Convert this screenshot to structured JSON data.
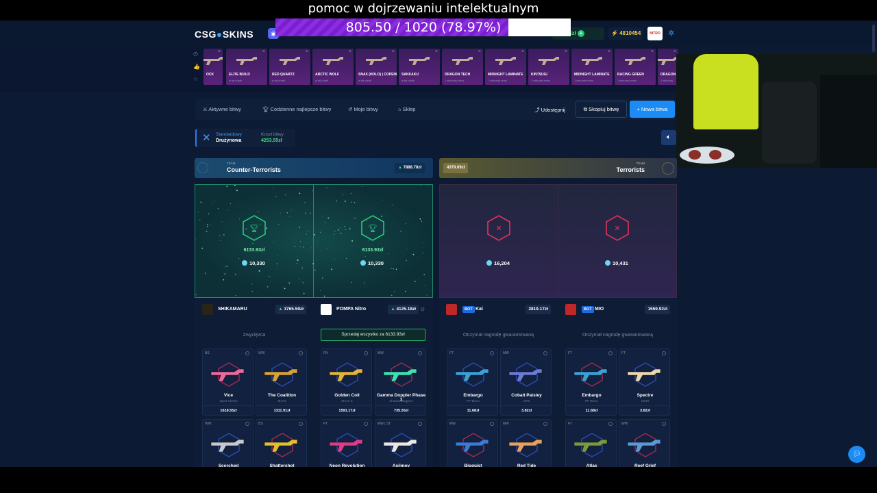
{
  "stream": {
    "title": "pomoc w dojrzewaniu intelektualnym",
    "progress_text": "805.50 / 1020 (78.97%)",
    "progress_fraction": 0.7897
  },
  "header": {
    "logo_left": "CSG",
    "logo_right": "SKINS",
    "balance_partial": "108.76zł",
    "coins": "4810454",
    "accent": "#1d8bf5"
  },
  "feed": [
    {
      "name": "OCK",
      "sub": "",
      "icon": "weapon-icon"
    },
    {
      "name": "ELITE BUILD",
      "sub": "w tej chwili",
      "icon": "rifle-icon"
    },
    {
      "name": "RED QUARTZ",
      "sub": "w tej chwili",
      "icon": "pistol-icon"
    },
    {
      "name": "ARCTIC WOLF",
      "sub": "w tej chwili",
      "icon": "rifle-icon"
    },
    {
      "name": "SNAX (HOLO) | COPENHAGEN 2024",
      "sub": "w tej chwili",
      "icon": "sticker-icon"
    },
    {
      "name": "SAKKAKU",
      "sub": "w tej chwili",
      "icon": "pistol-icon"
    },
    {
      "name": "DRAGON TECH",
      "sub": "1 sekundy temu",
      "icon": "rifle-icon"
    },
    {
      "name": "MIDNIGHT LAMINATE",
      "sub": "1 sekundy temu",
      "icon": "smg-icon"
    },
    {
      "name": "KINTSUGI",
      "sub": "1 sekundy temu",
      "icon": "pistol-icon"
    },
    {
      "name": "MIDNIGHT LAMINATE",
      "sub": "1 sekundy temu",
      "icon": "smg-icon"
    },
    {
      "name": "RACING GREEN",
      "sub": "1 sekundy temu",
      "icon": "rifle-icon"
    },
    {
      "name": "DRAGON",
      "sub": "1 sekundy",
      "icon": "rifle-icon"
    }
  ],
  "tabs": [
    {
      "label": "Aktywne bitwy",
      "icon": "swords-icon"
    },
    {
      "label": "Codzienne najlepsze bitwy",
      "icon": "trophy-icon"
    },
    {
      "label": "Moje bitwy",
      "icon": "history-icon"
    },
    {
      "label": "Sklep",
      "icon": "shop-icon"
    }
  ],
  "actions": {
    "share": "Udostępnij",
    "copy": "Skopiuj bitwę",
    "new": "+ Nowa bitwa"
  },
  "mode": {
    "label": "Standardowy",
    "sub": "Drużynowa",
    "cost_label": "Koszt bitwy",
    "cost": "4253.55zł"
  },
  "teams": {
    "ct": {
      "tag": "TEAM",
      "name": "Counter-Terrorists",
      "total": "7888.78zł"
    },
    "t": {
      "tag": "TEAM",
      "name": "Terrorists",
      "total": "4379.09zł"
    }
  },
  "slots": [
    {
      "result": "win",
      "amount": "6133.93zł",
      "coins": "10,330"
    },
    {
      "result": "win",
      "amount": "6133.93zł",
      "coins": "10,330"
    },
    {
      "result": "lose",
      "amount": "",
      "coins": "16,204"
    },
    {
      "result": "lose",
      "amount": "",
      "coins": "10,431"
    }
  ],
  "players": [
    {
      "name": "SHIKAMARU",
      "value": "3765.59zł",
      "bot": "",
      "status": "Zwycięzca"
    },
    {
      "name": "POMPA Nitro",
      "value": "4125.18zł",
      "bot": "",
      "status": "Sprzedaj wszystko za 6133.93zł"
    },
    {
      "name": "Kai",
      "value": "2819.17zł",
      "bot": "BOT",
      "status": "Otrzymał nagrodę gwarantowaną"
    },
    {
      "name": "MIO",
      "value": "1559.92zł",
      "bot": "BOT",
      "status": "Otrzymał nagrodę gwarantowaną"
    }
  ],
  "cards": [
    {
      "cond": "BS",
      "name": "Vice",
      "sub": "Sport Gloves",
      "price": "1618.55zł",
      "color": "#e86aa0"
    },
    {
      "cond": "WW",
      "name": "The Coalition",
      "sub": "M4A4",
      "price": "1311.91zł",
      "color": "#d4a23a"
    },
    {
      "cond": "FN",
      "name": "Golden Coil",
      "sub": "M4A1-S",
      "price": "1591.17zł",
      "color": "#e0b43c"
    },
    {
      "cond": "MW",
      "name": "Gamma Doppler Phase 3",
      "sub": "Shadow Daggers",
      "price": "735.55zł",
      "color": "#3de0b0"
    },
    {
      "cond": "FT",
      "name": "Embargo",
      "sub": "PP-Bizon",
      "price": "11.68zł",
      "color": "#3aa0d8"
    },
    {
      "cond": "MW",
      "name": "Cobalt Paisley",
      "sub": "MP9",
      "price": "3.82zł",
      "color": "#6a7ad8"
    },
    {
      "cond": "FT",
      "name": "Embargo",
      "sub": "PP-Bizon",
      "price": "11.68zł",
      "color": "#3aa0d8"
    },
    {
      "cond": "FT",
      "name": "Spectre",
      "sub": "M249",
      "price": "3.82zł",
      "color": "#e8d8b0"
    },
    {
      "cond": "WW",
      "name": "Scorched",
      "sub": "",
      "price": "",
      "color": "#c8c8d0"
    },
    {
      "cond": "BS",
      "name": "Shattershot",
      "sub": "",
      "price": "",
      "color": "#e0c030"
    },
    {
      "cond": "FT",
      "name": "Neon Revolution",
      "sub": "",
      "price": "",
      "color": "#e03a8a"
    },
    {
      "cond": "MW | ST",
      "name": "Asiimov",
      "sub": "",
      "price": "",
      "color": "#e8e8e8"
    },
    {
      "cond": "MW",
      "name": "Bioquist",
      "sub": "",
      "price": "",
      "color": "#3a7ad8"
    },
    {
      "cond": "MW",
      "name": "Red Tide",
      "sub": "",
      "price": "",
      "color": "#e8a060"
    },
    {
      "cond": "FT",
      "name": "Atlas",
      "sub": "",
      "price": "",
      "color": "#7a9a40"
    },
    {
      "cond": "WW",
      "name": "Reef Grief",
      "sub": "",
      "price": "",
      "color": "#5a9ad8"
    }
  ],
  "colors": {
    "win": "#27c77a",
    "lose": "#e0335a",
    "ct": "#2aa0c8",
    "t": "#c8b060"
  }
}
